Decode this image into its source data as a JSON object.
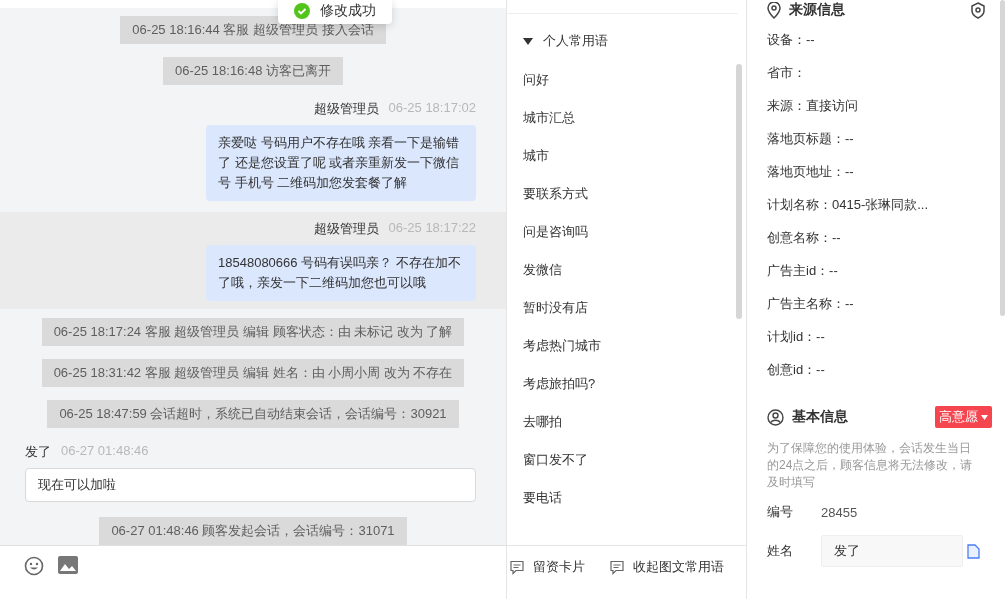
{
  "toast": {
    "text": "修改成功"
  },
  "chat": {
    "messages": [
      {
        "kind": "system",
        "text": "06-25 18:16:44 客服 超级管理员 接入会话"
      },
      {
        "kind": "system",
        "text": "06-25 18:16:48 访客已离开"
      },
      {
        "kind": "agent",
        "name": "超级管理员",
        "time": "06-25 18:17:02",
        "text": "亲爱哒 号码用户不存在哦 亲看一下是输错了 还是您设置了呢 或者亲重新发一下微信号 手机号 二维码加您发套餐了解",
        "highlighted": false
      },
      {
        "kind": "agent",
        "name": "超级管理员",
        "time": "06-25 18:17:22",
        "text": "18548080666  号码有误吗亲？ 不存在加不了哦，亲发一下二维码加您也可以哦",
        "highlighted": true
      },
      {
        "kind": "system",
        "text": "06-25 18:17:24 客服 超级管理员 编辑 顾客状态：由 未标记 改为 了解"
      },
      {
        "kind": "system",
        "text": "06-25 18:31:42 客服 超级管理员 编辑 姓名：由 小周小周 改为 不存在"
      },
      {
        "kind": "system",
        "text": "06-25 18:47:59 会话超时，系统已自动结束会话，会话编号：30921"
      },
      {
        "kind": "visitor",
        "name": "发了",
        "time": "06-27 01:48:46",
        "text": "现在可以加啦",
        "highlighted": false
      },
      {
        "kind": "system",
        "text": "06-27 01:48:46 顾客发起会话，会话编号：31071"
      }
    ]
  },
  "phrases": {
    "group": {
      "title": "个人常用语",
      "expanded": true
    },
    "items": [
      "问好",
      "城市汇总",
      "城市",
      "要联系方式",
      "问是咨询吗",
      "发微信",
      "暂时没有店",
      "考虑热门城市",
      "考虑旅拍吗?",
      "去哪拍",
      "窗口发不了",
      "要电话"
    ],
    "footer": [
      "留资卡片",
      "收起图文常用语"
    ]
  },
  "source_info": {
    "title": "来源信息",
    "rows": [
      "设备：--",
      "省市：",
      "来源：直接访问",
      "落地页标题：--",
      "落地页地址：--",
      "计划名称：0415-张琳同款...",
      "创意名称：--",
      "广告主id：--",
      "广告主名称：--",
      "计划id：--",
      "创意id：--"
    ]
  },
  "basic_info": {
    "title": "基本信息",
    "tag": "高意愿",
    "note": "为了保障您的使用体验，会话发生当日的24点之后，顾客信息将无法修改，请及时填写",
    "fields": [
      {
        "kind": "text",
        "label": "编号",
        "value": "28455"
      },
      {
        "kind": "input",
        "label": "姓名",
        "value": "发了"
      }
    ]
  }
}
